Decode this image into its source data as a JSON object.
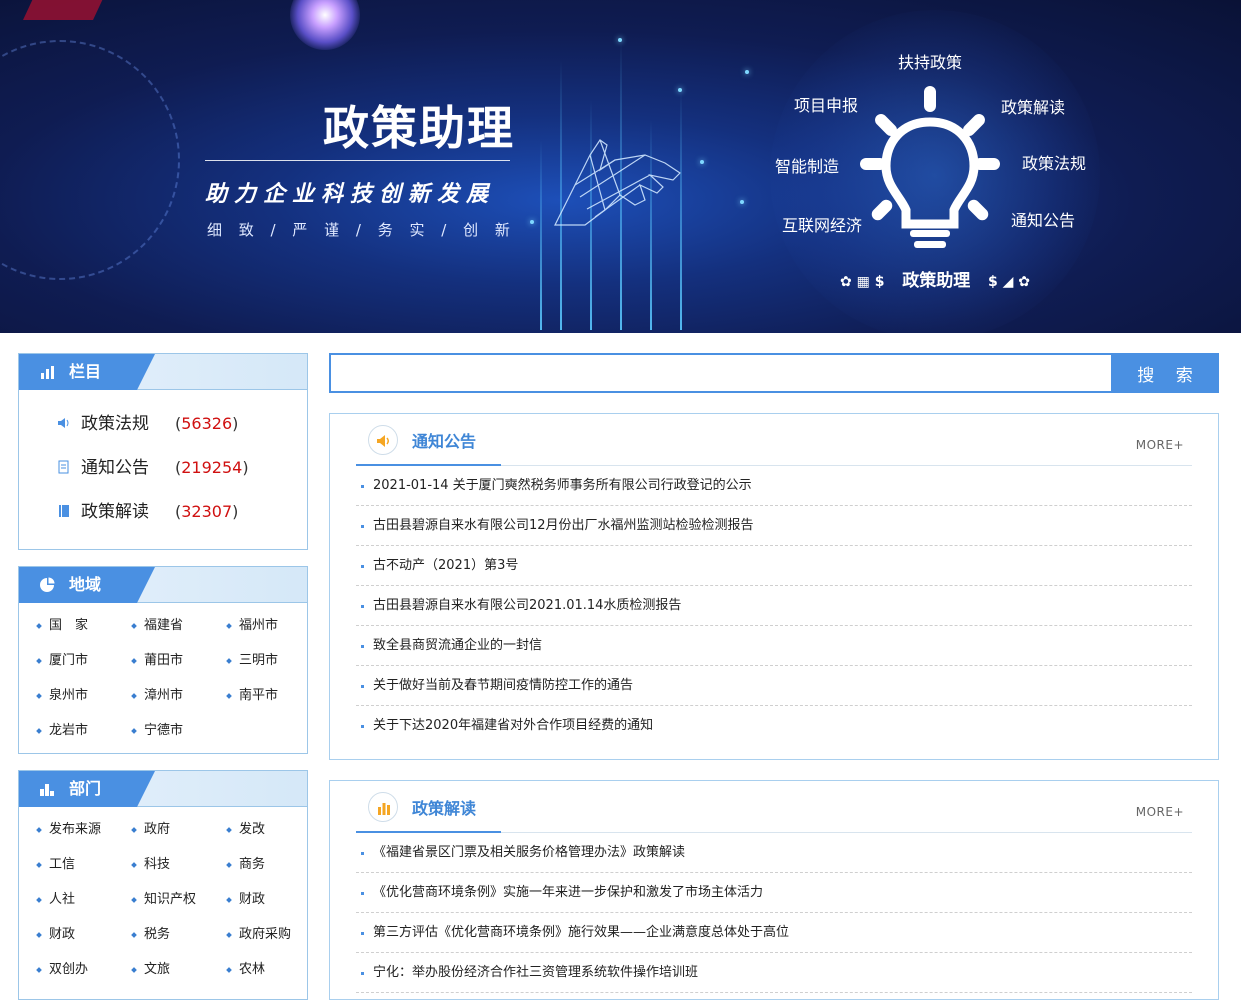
{
  "banner": {
    "title": "政策助理",
    "subtitle": "助力企业科技创新发展",
    "motto": "细 致 / 严 谨 / 务 实 / 创 新",
    "ring_labels": {
      "top": "扶持政策",
      "top_left": "项目申报",
      "top_right": "政策解读",
      "left": "智能制造",
      "right": "政策法规",
      "bottom_left": "互联网经济",
      "bottom_right": "通知公告"
    },
    "bottom_label": "政策助理",
    "bottom_left_symbols": "✿ ▦ $",
    "bottom_right_symbols": "$ ◢ ✿"
  },
  "sidebar": {
    "columns": {
      "title": "栏目",
      "items": [
        {
          "label": "政策法规",
          "count": "56326",
          "icon": "speaker-icon"
        },
        {
          "label": "通知公告",
          "count": "219254",
          "icon": "document-icon"
        },
        {
          "label": "政策解读",
          "count": "32307",
          "icon": "book-icon"
        }
      ]
    },
    "regions": {
      "title": "地域",
      "items": [
        "国　家",
        "福建省",
        "福州市",
        "厦门市",
        "莆田市",
        "三明市",
        "泉州市",
        "漳州市",
        "南平市",
        "龙岩市",
        "宁德市"
      ]
    },
    "departments": {
      "title": "部门",
      "items": [
        "发布来源",
        "政府",
        "发改",
        "工信",
        "科技",
        "商务",
        "人社",
        "知识产权",
        "财政",
        "财政",
        "税务",
        "政府采购",
        "双创办",
        "文旅",
        "农林"
      ]
    }
  },
  "search": {
    "placeholder": "",
    "button_label": "搜 索"
  },
  "notices": {
    "title": "通知公告",
    "more": "MORE+",
    "items": [
      "2021-01-14 关于厦门奭然税务师事务所有限公司行政登记的公示",
      "古田县碧源自来水有限公司12月份出厂水福州监测站检验检测报告",
      "古不动产（2021）第3号",
      "古田县碧源自来水有限公司2021.01.14水质检测报告",
      "致全县商贸流通企业的一封信",
      "关于做好当前及春节期间疫情防控工作的通告",
      "关于下达2020年福建省对外合作项目经费的通知"
    ]
  },
  "interpretations": {
    "title": "政策解读",
    "more": "MORE+",
    "items": [
      "《福建省景区门票及相关服务价格管理办法》政策解读",
      "《优化营商环境条例》实施一年来进一步保护和激发了市场主体活力",
      "第三方评估《优化营商环境条例》施行效果——企业满意度总体处于高位",
      "宁化：举办股份经济合作社三资管理系统软件操作培训班"
    ]
  },
  "colors": {
    "accent": "#4a90e2",
    "count_red": "#d01010",
    "title_blue": "#3f86d6",
    "notice_icon": "#f5a623"
  }
}
